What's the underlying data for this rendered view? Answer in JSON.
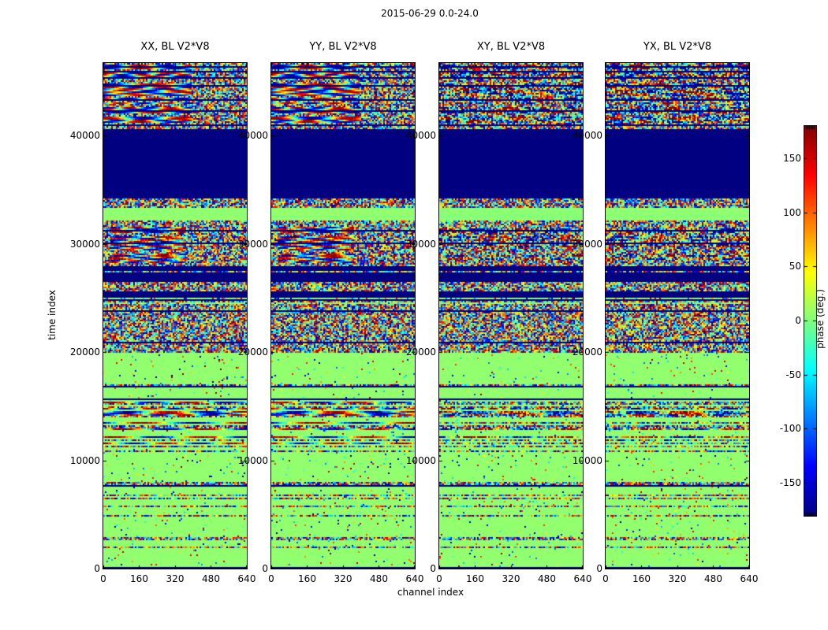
{
  "figure": {
    "title": "2015-06-29 0.0-24.0",
    "background": "#ffffff",
    "text_color": "#000000"
  },
  "axes": {
    "xlabel": "channel index",
    "ylabel": "time index",
    "xticks": [
      "0",
      "160",
      "320",
      "480",
      "640"
    ],
    "xtick_values": [
      0,
      160,
      320,
      480,
      640
    ],
    "yticks": [
      "0",
      "10000",
      "20000",
      "30000",
      "40000"
    ],
    "ytick_values": [
      0,
      10000,
      20000,
      30000,
      40000
    ],
    "xmax": 640,
    "tmax": 46700
  },
  "panels": [
    {
      "key": "xx",
      "title": "XX, BL V2*V8",
      "coherent": true,
      "seed": 101
    },
    {
      "key": "yy",
      "title": "YY, BL V2*V8",
      "coherent": true,
      "seed": 207
    },
    {
      "key": "xy",
      "title": "XY, BL V2*V8",
      "coherent": false,
      "seed": 313
    },
    {
      "key": "yx",
      "title": "YX, BL V2*V8",
      "coherent": false,
      "seed": 419
    }
  ],
  "colorbar": {
    "label": "phase (deg.)",
    "ticks": [
      "150",
      "100",
      "50",
      "0",
      "-50",
      "-100",
      "-150"
    ],
    "tick_values": [
      150,
      100,
      50,
      0,
      -50,
      -100,
      -150
    ],
    "vmin": -180,
    "vmax": 180,
    "colormap": "jet",
    "navy": "#000080",
    "mid_green": "#80ff80",
    "dark_red": "#800000"
  },
  "chart_data": {
    "type": "heatmap",
    "title": "2015-06-29 0.0-24.0",
    "xlabel": "channel index",
    "ylabel": "time index",
    "colorbar_label": "phase (deg.)",
    "x_range": [
      0,
      640
    ],
    "y_range": [
      0,
      46700
    ],
    "value_range": [
      -180,
      180
    ],
    "colormap": "jet",
    "legend_position": "right-colorbar",
    "grid": false,
    "panel_titles": [
      "XX, BL V2*V8",
      "YY, BL V2*V8",
      "XY, BL V2*V8",
      "YX, BL V2*V8"
    ],
    "bands": [
      {
        "t0": 41200,
        "t1": 46700,
        "type": "wavy",
        "note": "coherent rainbow sinusoid scanlines in XX/YY left 60%, speckle right; noisier in XY/YX"
      },
      {
        "t0": 40700,
        "t1": 41200,
        "type": "speckle"
      },
      {
        "t0": 34300,
        "t1": 40700,
        "type": "navy",
        "note": "solid -180 deg block"
      },
      {
        "t0": 33450,
        "t1": 34300,
        "type": "speckle"
      },
      {
        "t0": 32290,
        "t1": 33450,
        "type": "green",
        "note": "solid ~0 deg band"
      },
      {
        "t0": 31630,
        "t1": 32290,
        "type": "speckle"
      },
      {
        "t0": 28000,
        "t1": 31630,
        "type": "blobs",
        "note": "red/yellow wavy patches in XX/YY, speckle+navy rows in XY/YX"
      },
      {
        "t0": 26550,
        "t1": 28000,
        "type": "navy_lines"
      },
      {
        "t0": 25670,
        "t1": 26550,
        "type": "speckle"
      },
      {
        "t0": 25160,
        "t1": 25670,
        "type": "navy"
      },
      {
        "t0": 20000,
        "t1": 25160,
        "type": "speckle_dense"
      },
      {
        "t0": 15500,
        "t1": 20000,
        "type": "green_stripes",
        "stripe_p": 0.12
      },
      {
        "t0": 10700,
        "t1": 15500,
        "type": "green_wavy",
        "note": "green background with drifting rainbow streak rows"
      },
      {
        "t0": 0,
        "t1": 10700,
        "type": "green_stripes",
        "stripe_p": 0.18
      }
    ]
  }
}
